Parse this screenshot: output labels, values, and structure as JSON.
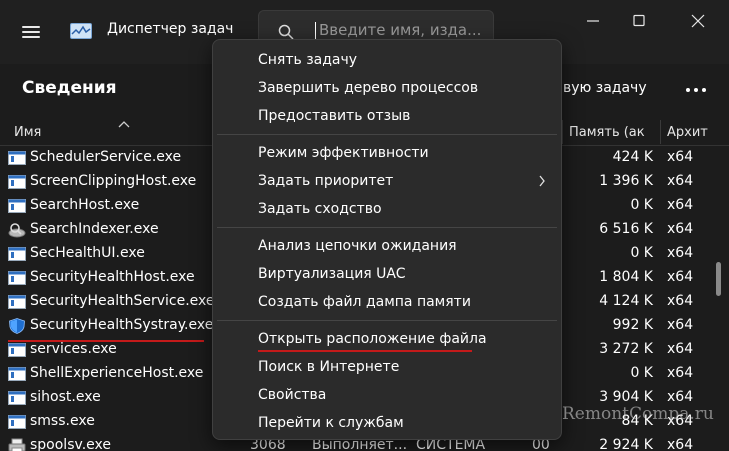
{
  "window": {
    "title": "Диспетчер задач",
    "search_placeholder": "Введите имя, изда..."
  },
  "toolbar": {
    "page_title": "Сведения",
    "new_task_label": "вую задачу"
  },
  "columns": {
    "name": "Имя",
    "memory": "Память (ак",
    "arch": "Архит"
  },
  "processes": [
    {
      "name": "SchedulerService.exe",
      "memory": "424 K",
      "arch": "x64",
      "icon": "app-window-icon"
    },
    {
      "name": "ScreenClippingHost.exe",
      "memory": "1 396 K",
      "arch": "x64",
      "icon": "app-window-icon"
    },
    {
      "name": "SearchHost.exe",
      "memory": "0 K",
      "arch": "x64",
      "icon": "app-window-icon"
    },
    {
      "name": "SearchIndexer.exe",
      "memory": "6 516 K",
      "arch": "x64",
      "icon": "indexer-icon"
    },
    {
      "name": "SecHealthUI.exe",
      "memory": "0 K",
      "arch": "x64",
      "icon": "app-window-icon"
    },
    {
      "name": "SecurityHealthHost.exe",
      "memory": "1 804 K",
      "arch": "x64",
      "icon": "app-window-icon"
    },
    {
      "name": "SecurityHealthService.exe",
      "memory": "4 124 K",
      "arch": "x64",
      "icon": "app-window-icon"
    },
    {
      "name": "SecurityHealthSystray.exe",
      "memory": "992 K",
      "arch": "x64",
      "icon": "shield-icon"
    },
    {
      "name": "services.exe",
      "memory": "3 272 K",
      "arch": "x64",
      "icon": "app-window-icon"
    },
    {
      "name": "ShellExperienceHost.exe",
      "memory": "0 K",
      "arch": "x64",
      "icon": "app-window-icon"
    },
    {
      "name": "sihost.exe",
      "memory": "3 904 K",
      "arch": "x64",
      "icon": "app-window-icon"
    },
    {
      "name": "smss.exe",
      "memory": "84 K",
      "arch": "x64",
      "icon": "app-window-icon"
    },
    {
      "name": "spoolsv.exe",
      "pid": "3068",
      "status": "Выполняет...",
      "user": "СИСТЕМА",
      "cpu": "00",
      "memory": "2 924 K",
      "arch": "x64",
      "icon": "printer-icon"
    }
  ],
  "context_menu": {
    "items": [
      {
        "label": "Снять задачу"
      },
      {
        "label": "Завершить дерево процессов"
      },
      {
        "label": "Предоставить отзыв"
      },
      {
        "label": "Режим эффективности"
      },
      {
        "label": "Задать приоритет"
      },
      {
        "label": "Задать сходство"
      },
      {
        "label": "Анализ цепочки ожидания"
      },
      {
        "label": "Виртуализация UAC"
      },
      {
        "label": "Создать файл дампа памяти"
      },
      {
        "label": "Открыть расположение файла"
      },
      {
        "label": "Поиск в Интернете"
      },
      {
        "label": "Свойства"
      },
      {
        "label": "Перейти к службам"
      }
    ]
  },
  "watermark": "RemontCompa.ru",
  "colors": {
    "highlight_underline": "#c41a1a",
    "background": "#1c1c1c",
    "menu_bg": "#2b2b2b"
  }
}
